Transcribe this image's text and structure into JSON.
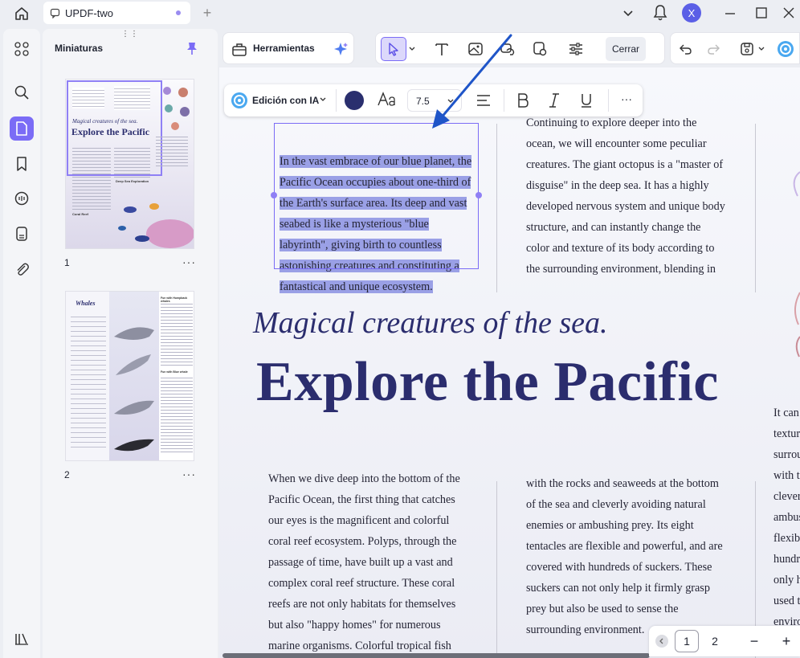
{
  "window": {
    "tab_title": "UPDF-two",
    "avatar_initial": "X"
  },
  "panel": {
    "title": "Miniaturas",
    "pages": [
      {
        "number": "1",
        "more": "···"
      },
      {
        "number": "2",
        "more": "···"
      }
    ],
    "thumb1": {
      "subtitle": "Magical creatures of the sea.",
      "title": "Explore the Pacific",
      "caption": "Coral Reef",
      "sidebar_head": "Deep Sea Exploration"
    },
    "thumb2": {
      "title": "Whales",
      "head1": "Fun with Humpback whales",
      "head2": "Fun with Blue whale"
    }
  },
  "toolbar": {
    "tools_label": "Herramientas",
    "close_label": "Cerrar"
  },
  "ai_bar": {
    "label": "Edición con IA",
    "font_size": "7.5",
    "more": "···",
    "text_color": "#2a2f6e"
  },
  "document": {
    "para_top_left": [
      "In the vast embrace of our blue planet, the",
      "Pacific Ocean occupies about one-third of",
      "the Earth's surface area. Its deep and vast",
      "seabed is like a mysterious \"blue",
      "labyrinth\", giving birth to countless",
      "astonishing creatures and constituting a",
      "fantastical and unique ecosystem."
    ],
    "para_top_right": [
      "Continuing to explore deeper into the",
      "ocean, we will encounter some peculiar",
      "creatures. The giant octopus is a \"master of",
      "disguise\" in the deep sea. It has a highly",
      "developed nervous system and unique body",
      "structure, and can instantly change the",
      "color and texture of its body according to",
      "the surrounding environment, blending in"
    ],
    "subtitle": "Magical creatures of the sea.",
    "title": "Explore the Pacific",
    "para_bottom_left": [
      "When we dive deep into the bottom of the",
      "Pacific Ocean, the first thing that catches",
      "our eyes is the magnificent and colorful",
      "coral reef ecosystem. Polyps, through the",
      "passage of time, have built up a vast and",
      "complex coral reef structure. These coral",
      "reefs are not only habitats for themselves",
      "but also \"happy homes\" for numerous",
      "marine organisms. Colorful tropical fish"
    ],
    "para_bottom_right": [
      "with the rocks and seaweeds at the bottom",
      "of the sea and cleverly avoiding natural",
      "enemies or ambushing prey. Its eight",
      "tentacles are flexible and powerful, and are",
      "covered with hundreds of suckers. These",
      "suckers can not only help it firmly grasp",
      "prey but also be used to sense the",
      "surrounding environment."
    ],
    "para_far_right": [
      "It can",
      "textur",
      "surrou",
      "with t",
      "clever",
      "ambus",
      "flexib",
      "hundr",
      "only h",
      "used t",
      "enviro"
    ],
    "title_color": "#2b2d6e",
    "highlight_color": "#9aa0e6"
  },
  "pager": {
    "pages": [
      "1",
      "2"
    ],
    "zoom_out": "−",
    "zoom_in": "+"
  },
  "colors": {
    "accent": "#7b6cf6",
    "arrow": "#1f55c8"
  }
}
